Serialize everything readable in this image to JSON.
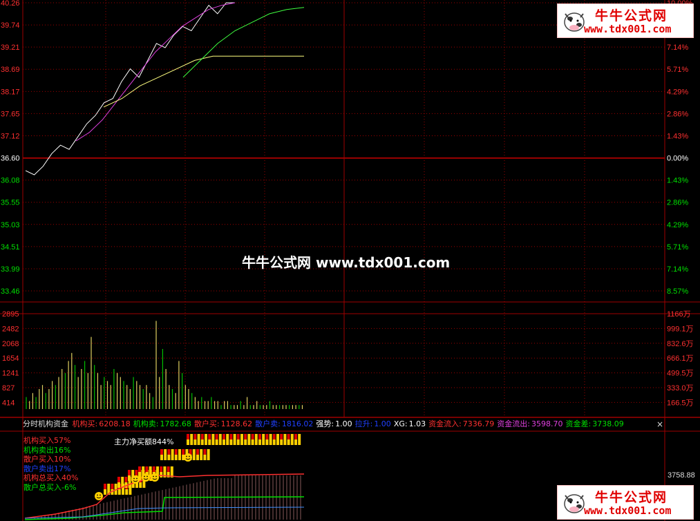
{
  "price_axis": {
    "left_labels": [
      "40.26",
      "39.74",
      "39.21",
      "38.69",
      "38.17",
      "37.65",
      "37.12",
      "36.60",
      "36.08",
      "35.55",
      "35.03",
      "34.51",
      "33.99",
      "33.46"
    ],
    "right_labels": [
      "10.00%",
      "8.57%",
      "7.14%",
      "5.71%",
      "4.29%",
      "2.86%",
      "1.43%",
      "0.00%",
      "1.43%",
      "2.86%",
      "4.29%",
      "5.71%",
      "7.14%",
      "8.57%"
    ]
  },
  "volume_axis": {
    "left_labels": [
      "2895",
      "2482",
      "2068",
      "1654",
      "1241",
      "827",
      "414"
    ],
    "right_labels": [
      "1166万",
      "999.1万",
      "832.6万",
      "666.1万",
      "499.5万",
      "333.0万",
      "166.5万"
    ]
  },
  "indicator_bar": {
    "title": "分时机构资金",
    "items": [
      {
        "label": "机构买:",
        "value": "6208.18",
        "color": "#ff3030"
      },
      {
        "label": "机构卖:",
        "value": "1782.68",
        "color": "#00e000"
      },
      {
        "label": "散户买:",
        "value": "1128.62",
        "color": "#ff3030"
      },
      {
        "label": "散户卖:",
        "value": "1816.02",
        "color": "#2040ff"
      },
      {
        "label": "强势:",
        "value": "1.00",
        "color": "#ffffff"
      },
      {
        "label": "拉升:",
        "value": "1.00",
        "color": "#2040ff"
      },
      {
        "label": "XG:",
        "value": "1.03",
        "color": "#ffffff"
      },
      {
        "label": "资金流入:",
        "value": "7336.79",
        "color": "#ff3030"
      },
      {
        "label": "资金流出:",
        "value": "3598.70",
        "color": "#e040e0"
      },
      {
        "label": "资金差:",
        "value": "3738.09",
        "color": "#00e000"
      }
    ],
    "close": "×"
  },
  "indicator_legend": [
    {
      "text": "机构买入57%",
      "color": "#ff3030"
    },
    {
      "text": "机构卖出16%",
      "color": "#00e000"
    },
    {
      "text": "散户买入10%",
      "color": "#ff3030"
    },
    {
      "text": "散户卖出17%",
      "color": "#2040ff"
    },
    {
      "text": "机构总买入40%",
      "color": "#ff3030"
    },
    {
      "text": "散户总买入-6%",
      "color": "#00e000"
    }
  ],
  "net_label": "主力净买额844%",
  "indicator_right_value": "3758.88",
  "watermark": "牛牛公式网 www.tdx001.com",
  "logo": {
    "title": "牛牛公式网",
    "url": "www.tdx001.com"
  },
  "colors": {
    "grid": "#a00000",
    "up": "#ff3030",
    "down": "#00e000",
    "axis_text_left": "#ff3030",
    "axis_text_right": "#ff3030"
  },
  "chart_data": {
    "type": "line",
    "title": "",
    "xlabel": "",
    "ylabel": "",
    "ylim": [
      33.46,
      40.26
    ],
    "series": [
      {
        "name": "",
        "color": "#ffffff",
        "values": [
          36.3,
          36.2,
          36.4,
          36.7,
          36.9,
          36.8,
          37.1,
          37.4,
          37.6,
          37.9,
          38.0,
          38.4,
          38.7,
          38.5,
          38.9,
          39.3,
          39.2,
          39.5,
          39.7,
          39.6,
          39.9,
          40.2,
          40.0,
          40.26,
          40.26
        ]
      },
      {
        "name": "",
        "color": "#e040e0",
        "values": [
          37.0,
          37.2,
          37.5,
          37.9,
          38.3,
          38.7,
          39.1,
          39.4,
          39.7,
          39.9,
          40.1,
          40.2,
          40.26
        ]
      },
      {
        "name": "",
        "color": "#ffff80",
        "values": [
          37.8,
          38.0,
          38.3,
          38.5,
          38.7,
          38.9,
          39.0,
          39.0,
          39.0,
          39.0,
          39.0,
          39.0
        ]
      },
      {
        "name": "",
        "color": "#40ff40",
        "values": [
          38.5,
          38.9,
          39.3,
          39.6,
          39.8,
          40.0,
          40.1,
          40.15
        ]
      }
    ],
    "volume": [
      3,
      2,
      4,
      3,
      5,
      6,
      4,
      5,
      7,
      6,
      8,
      10,
      9,
      12,
      14,
      11,
      8,
      10,
      12,
      9,
      18,
      11,
      9,
      6,
      8,
      7,
      6,
      10,
      9,
      8,
      7,
      6,
      5,
      8,
      7,
      6,
      5,
      6,
      4,
      3,
      22,
      8,
      15,
      10,
      6,
      5,
      4,
      12,
      9,
      6,
      5,
      4,
      3,
      2,
      3,
      2,
      2,
      3,
      2,
      2,
      1,
      2,
      2,
      1,
      1,
      1,
      2,
      1,
      3,
      1,
      1,
      2,
      1,
      1,
      1,
      2,
      1,
      1,
      1,
      1,
      1,
      1,
      1,
      1,
      1,
      1
    ]
  }
}
